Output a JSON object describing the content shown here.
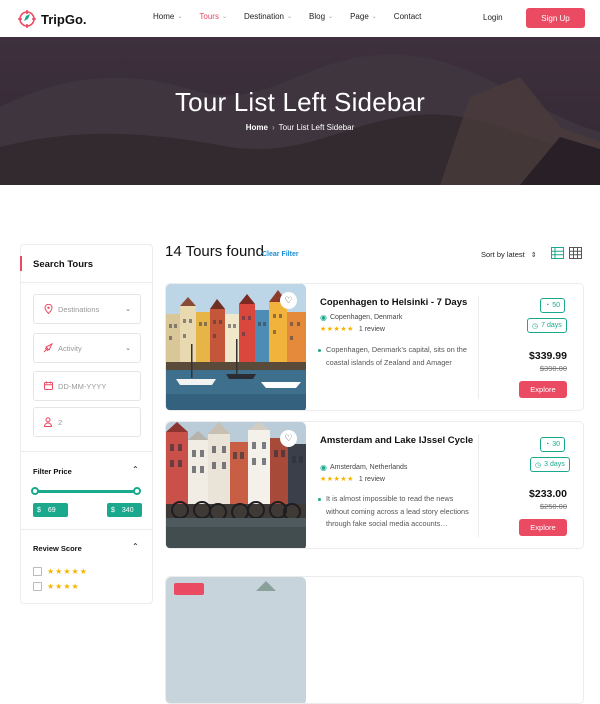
{
  "brand": {
    "name": "TripGo.",
    "accent": "#eb4a63",
    "teal": "#1ba98e"
  },
  "nav": {
    "items": [
      {
        "label": "Home",
        "has_dropdown": true
      },
      {
        "label": "Tours",
        "has_dropdown": true,
        "active": true
      },
      {
        "label": "Destination",
        "has_dropdown": true
      },
      {
        "label": "Blog",
        "has_dropdown": true
      },
      {
        "label": "Page",
        "has_dropdown": true
      },
      {
        "label": "Contact",
        "has_dropdown": false
      }
    ],
    "login": "Login",
    "signup": "Sign Up"
  },
  "hero": {
    "title": "Tour List Left Sidebar",
    "breadcrumb": {
      "home": "Home",
      "current": "Tour List Left Sidebar"
    }
  },
  "sidebar": {
    "title": "Search Tours",
    "destinations_placeholder": "Destinations",
    "activity_placeholder": "Activity",
    "date_placeholder": "DD-MM-YYYY",
    "guests_value": "2",
    "filter_price_label": "Filter Price",
    "price_min": "69",
    "price_max": "340",
    "currency": "$",
    "review_label": "Review Score",
    "review_options": [
      5,
      4
    ]
  },
  "results": {
    "count_text": "14 Tours found",
    "clear_filter": "Clear Filter",
    "sort_label": "Sort by latest"
  },
  "tours": [
    {
      "title": "Copenhagen to Helsinki - 7 Days",
      "location": "Copenhagen, Denmark",
      "rating": 5,
      "reviews": "1 review",
      "description": "Copenhagen, Denmark's capital, sits on the coastal islands of Zealand and Amager",
      "people": "50",
      "duration": "7 days",
      "price": "$339.99",
      "old_price": "$390.00",
      "cta": "Explore"
    },
    {
      "title": "Amsterdam and Lake IJssel Cycle",
      "location": "Amsterdam, Netherlands",
      "rating": 5,
      "reviews": "1 review",
      "description": "It is almost impossible to read the news without coming across a lead story elections through fake social media accounts…",
      "people": "30",
      "duration": "3 days",
      "price": "$233.00",
      "old_price": "$250.00",
      "cta": "Explore"
    }
  ]
}
